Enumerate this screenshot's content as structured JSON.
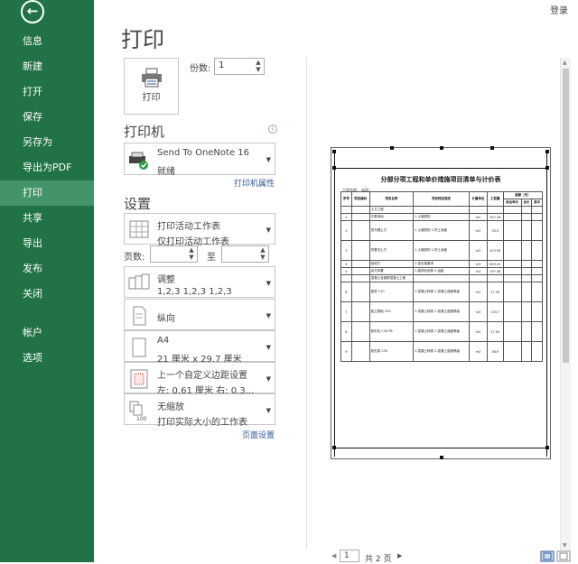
{
  "header": {
    "title": "打印",
    "login": "登录"
  },
  "sidebar": {
    "items": [
      {
        "label": "信息"
      },
      {
        "label": "新建"
      },
      {
        "label": "打开"
      },
      {
        "label": "保存"
      },
      {
        "label": "另存为"
      },
      {
        "label": "导出为PDF"
      },
      {
        "label": "打印"
      },
      {
        "label": "共享"
      },
      {
        "label": "导出"
      },
      {
        "label": "发布"
      },
      {
        "label": "关闭"
      },
      {
        "label": "帐户"
      },
      {
        "label": "选项"
      }
    ],
    "active": "打印"
  },
  "print": {
    "button_label": "打印",
    "copies_label": "份数:",
    "copies_value": "1"
  },
  "printer": {
    "heading": "打印机",
    "name": "Send To OneNote 16",
    "status": "就绪",
    "properties_link": "打印机属性"
  },
  "settings": {
    "heading": "设置",
    "scope": {
      "title": "打印活动工作表",
      "subtitle": "仅打印活动工作表"
    },
    "pages_label": "页数:",
    "pages_to": "至",
    "collate": {
      "title": "调整",
      "subtitle": "1,2,3    1,2,3    1,2,3"
    },
    "orientation": {
      "title": "纵向"
    },
    "paper": {
      "title": "A4",
      "subtitle": "21 厘米 x 29.7 厘米"
    },
    "margins": {
      "title": "上一个自定义边距设置",
      "subtitle": "左: 0.61 厘米    右: 0.3..."
    },
    "scaling": {
      "title": "无缩放",
      "subtitle": "打印实际大小的工作表"
    },
    "page_setup_link": "页面设置"
  },
  "preview": {
    "sheet_title": "分部分项工程和单价措施项目清单与计价表",
    "sheet_subtitle": "工程名称：  标段：",
    "headers": [
      "序号",
      "项目编码",
      "项目名称",
      "项目特征描述",
      "计量单位",
      "工程量",
      "金额（元）"
    ],
    "money_headers": [
      "综合单价",
      "合价",
      "其中"
    ],
    "rows": [
      {
        "no": "",
        "name": "土方工程",
        "desc": "",
        "unit": "",
        "qty": ""
      },
      {
        "no": "1",
        "name": "平整场地",
        "desc": "1.土壤类别",
        "unit": "m2",
        "qty": "307.78"
      },
      {
        "no": "2",
        "name": "挖沟槽土方",
        "desc": "1.土壤类别 2.挖土深度",
        "unit": "m3",
        "qty": "30.9"
      },
      {
        "no": "3",
        "name": "挖基坑土方",
        "desc": "1.土壤类别 2.挖土深度",
        "unit": "m3",
        "qty": "423.59"
      },
      {
        "no": "4",
        "name": "回填方",
        "desc": "1.密实度要求",
        "unit": "m3",
        "qty": "655.42"
      },
      {
        "no": "5",
        "name": "余方弃置",
        "desc": "1.废弃料品种 2.运距",
        "unit": "m3",
        "qty": "197.38"
      },
      {
        "no": "",
        "name": "混凝土及钢筋混凝土工程",
        "desc": "",
        "unit": "",
        "qty": ""
      },
      {
        "no": "6",
        "name": "垫层 C10",
        "desc": "1.混凝土种类 2.混凝土强度等级",
        "unit": "m3",
        "qty": "27.39"
      },
      {
        "no": "7",
        "name": "独立基础 C30",
        "desc": "1.混凝土种类 2.混凝土强度等级",
        "unit": "m3",
        "qty": "133.7"
      },
      {
        "no": "8",
        "name": "矩形柱 C30 P6",
        "desc": "1.混凝土种类 2.混凝土强度等级",
        "unit": "m3",
        "qty": "27.95"
      },
      {
        "no": "9",
        "name": "矩形梁 C30",
        "desc": "1.混凝土种类 2.混凝土强度等级",
        "unit": "m3",
        "qty": "38.9"
      }
    ]
  },
  "pager": {
    "current": "1",
    "of_text": "共 2 页"
  },
  "colors": {
    "sidebar": "#217346",
    "active_nav": "#439467",
    "link": "#2b579a"
  }
}
